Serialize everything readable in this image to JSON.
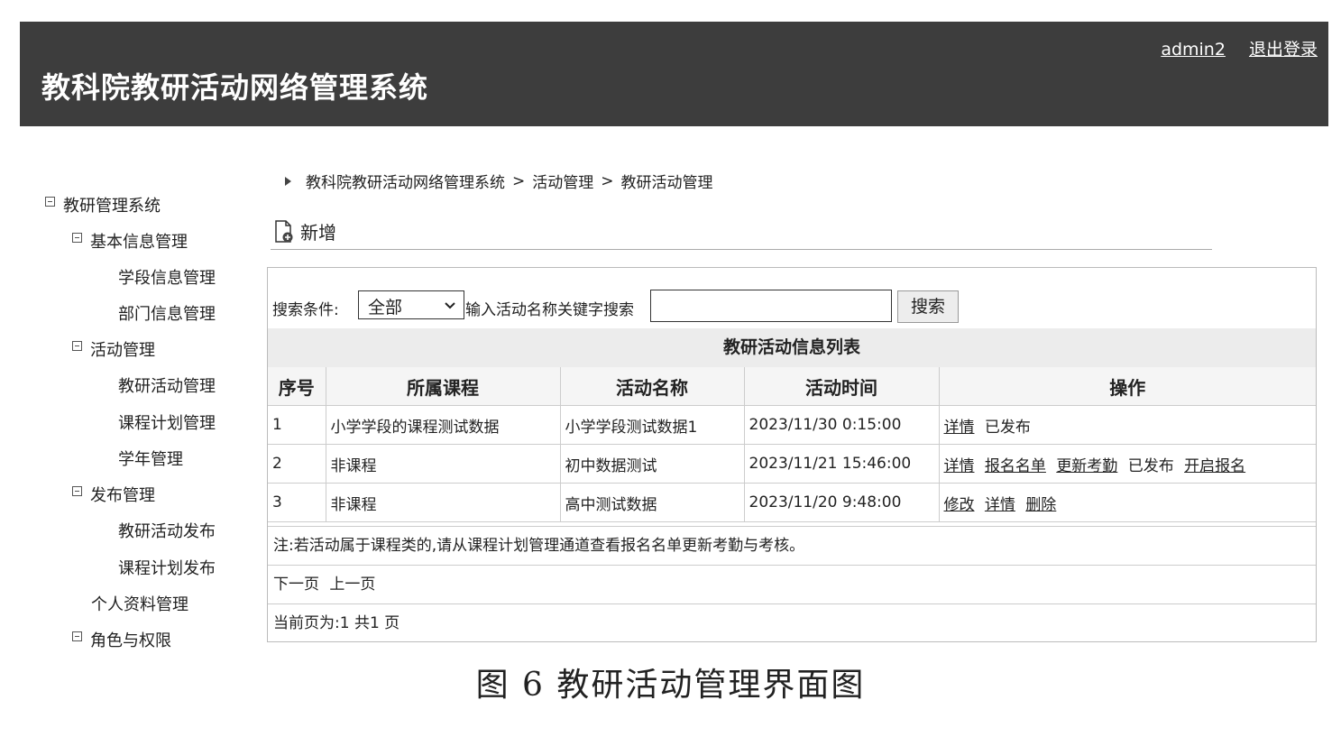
{
  "header": {
    "title": "教科院教研活动网络管理系统",
    "username": "admin2",
    "logout_label": "退出登录"
  },
  "sidebar": {
    "root": "教研管理系统",
    "groups": [
      {
        "label": "基本信息管理",
        "items": [
          "学段信息管理",
          "部门信息管理"
        ]
      },
      {
        "label": "活动管理",
        "items": [
          "教研活动管理",
          "课程计划管理",
          "学年管理"
        ]
      },
      {
        "label": "发布管理",
        "items": [
          "教研活动发布",
          "课程计划发布"
        ]
      }
    ],
    "standalone_item": "个人资料管理",
    "last_group": "角色与权限"
  },
  "breadcrumb": {
    "items": [
      "教科院教研活动网络管理系统",
      "活动管理",
      "教研活动管理"
    ],
    "separator": ">"
  },
  "toolbar": {
    "new_label": "新增"
  },
  "search": {
    "condition_label": "搜索条件:",
    "selected_option": "全部",
    "keyword_label": "输入活动名称关键字搜索",
    "input_value": "",
    "button_label": "搜索"
  },
  "table": {
    "title": "教研活动信息列表",
    "columns": [
      "序号",
      "所属课程",
      "活动名称",
      "活动时间",
      "操作"
    ],
    "rows": [
      {
        "index": "1",
        "course": "小学学段的课程测试数据",
        "name": "小学学段测试数据1",
        "time": "2023/11/30 0:15:00",
        "actions": [
          {
            "label": "详情",
            "link": true
          },
          {
            "label": "已发布",
            "link": false
          }
        ]
      },
      {
        "index": "2",
        "course": "非课程",
        "name": "初中数据测试",
        "time": "2023/11/21 15:46:00",
        "actions": [
          {
            "label": "详情",
            "link": true
          },
          {
            "label": "报名名单",
            "link": true
          },
          {
            "label": "更新考勤",
            "link": true
          },
          {
            "label": "已发布",
            "link": false
          },
          {
            "label": "开启报名",
            "link": true
          }
        ]
      },
      {
        "index": "3",
        "course": "非课程",
        "name": "高中测试数据",
        "time": "2023/11/20 9:48:00",
        "actions": [
          {
            "label": "修改",
            "link": true
          },
          {
            "label": "详情",
            "link": true
          },
          {
            "label": "删除",
            "link": true
          }
        ]
      }
    ],
    "note": "注:若活动属于课程类的,请从课程计划管理通道查看报名名单更新考勤与考核。",
    "pager": {
      "next": "下一页",
      "prev": "上一页"
    },
    "page_info": "当前页为:1 共1 页"
  },
  "caption": "图 6 教研活动管理界面图"
}
